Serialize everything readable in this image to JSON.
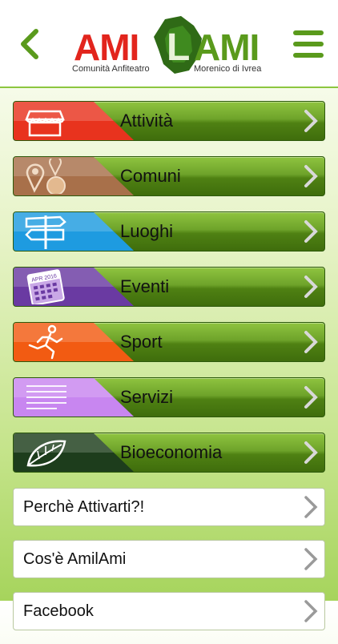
{
  "header": {
    "back_icon": "chevron-left-icon",
    "menu_icon": "hamburger-menu-icon",
    "logo": {
      "left_word": "AMI",
      "middle_letter": "L",
      "right_word": "AMI",
      "sub_left": "Comunità Anfiteatro",
      "sub_right": "Morenico di Ivrea",
      "colors": {
        "red": "#e2251d",
        "green": "#5a9a1c"
      }
    }
  },
  "menu": {
    "items": [
      {
        "label": "Attività",
        "icon": "shop-icon",
        "color": "#e8331e"
      },
      {
        "label": "Comuni",
        "icon": "map-pin-icon",
        "color": "#a8704a"
      },
      {
        "label": "Luoghi",
        "icon": "signpost-icon",
        "color": "#1e9be0"
      },
      {
        "label": "Eventi",
        "icon": "calendar-icon",
        "color": "#6a3aa2",
        "icon_text": "APR 2016"
      },
      {
        "label": "Sport",
        "icon": "runner-icon",
        "color": "#f25b12"
      },
      {
        "label": "Servizi",
        "icon": "list-lines-icon",
        "color": "#c886f0"
      },
      {
        "label": "Bioeconomia",
        "icon": "leaf-icon",
        "color": "#1d3d1c"
      }
    ],
    "links": [
      {
        "label": "Perchè Attivarti?!"
      },
      {
        "label": "Cos'è AmilAmi"
      },
      {
        "label": "Facebook"
      }
    ],
    "chevron_icon": "chevron-right-icon",
    "accent": "#6ea32a"
  }
}
